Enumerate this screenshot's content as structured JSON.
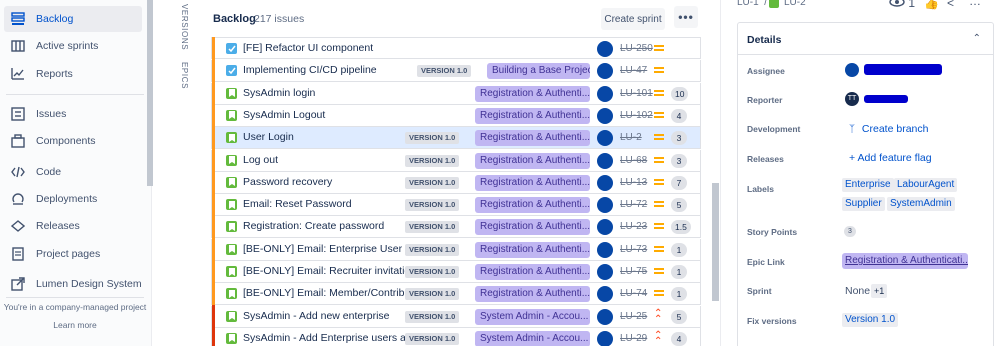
{
  "sidebar": {
    "items": [
      {
        "label": "Backlog",
        "icon": "backlog-icon",
        "active": true
      },
      {
        "label": "Active sprints",
        "icon": "board-icon"
      },
      {
        "label": "Reports",
        "icon": "reports-icon"
      },
      {
        "label": "Issues",
        "icon": "issues-icon"
      },
      {
        "label": "Components",
        "icon": "components-icon"
      },
      {
        "label": "Code",
        "icon": "code-icon"
      },
      {
        "label": "Deployments",
        "icon": "deployments-icon"
      },
      {
        "label": "Releases",
        "icon": "releases-icon"
      },
      {
        "label": "Project pages",
        "icon": "pages-icon"
      },
      {
        "label": "Lumen Design System",
        "icon": "external-link-icon"
      }
    ],
    "footer_text": "You're in a company-managed project",
    "learn_more": "Learn more"
  },
  "vertical_tabs": {
    "versions": "VERSIONS",
    "epics": "EPICS"
  },
  "backlog": {
    "title": "Backlog",
    "count": "217 issues",
    "create_sprint": "Create sprint",
    "more": "•••"
  },
  "issues": [
    {
      "summary": "[FE] Refactor UI component",
      "type": "task",
      "version": "",
      "epic": "",
      "key": "LU-250",
      "priority": "medium",
      "points": ""
    },
    {
      "summary": "Implementing CI/CD pipeline",
      "type": "task",
      "version": "VERSION 1.0",
      "epic": "Building a Base Project",
      "key": "LU-47",
      "priority": "medium",
      "points": ""
    },
    {
      "summary": "SysAdmin login",
      "type": "story",
      "version": "",
      "epic": "Registration & Authenti...",
      "key": "LU-101",
      "priority": "medium",
      "points": "10"
    },
    {
      "summary": "SysAdmin Logout",
      "type": "story",
      "version": "",
      "epic": "Registration & Authenti...",
      "key": "LU-102",
      "priority": "medium",
      "points": "4"
    },
    {
      "summary": "User Login",
      "type": "story",
      "version": "VERSION 1.0",
      "epic": "Registration & Authenti...",
      "key": "LU-2",
      "priority": "medium",
      "points": "3",
      "selected": true
    },
    {
      "summary": "Log out",
      "type": "story",
      "version": "VERSION 1.0",
      "epic": "Registration & Authenti...",
      "key": "LU-68",
      "priority": "medium",
      "points": "3"
    },
    {
      "summary": "Password recovery",
      "type": "story",
      "version": "VERSION 1.0",
      "epic": "Registration & Authenti...",
      "key": "LU-13",
      "priority": "medium",
      "points": "7"
    },
    {
      "summary": "Email: Reset Password",
      "type": "story",
      "version": "VERSION 1.0",
      "epic": "Registration & Authenti...",
      "key": "LU-72",
      "priority": "medium",
      "points": "5"
    },
    {
      "summary": "Registration: Create password",
      "type": "story",
      "version": "VERSION 1.0",
      "epic": "Registration & Authenti...",
      "key": "LU-23",
      "priority": "medium",
      "points": "1.5"
    },
    {
      "summary": "[BE-ONLY] Email: Enterprise User invitation",
      "type": "story",
      "version": "VERSION 1.0",
      "epic": "Registration & Authenti...",
      "key": "LU-73",
      "priority": "medium",
      "points": "1"
    },
    {
      "summary": "[BE-ONLY] Email: Recruiter invitation",
      "type": "story",
      "version": "VERSION 1.0",
      "epic": "Registration & Authenti...",
      "key": "LU-75",
      "priority": "medium",
      "points": "1"
    },
    {
      "summary": "[BE-ONLY] Email: Member/Contributor Invitation",
      "type": "story",
      "version": "VERSION 1.0",
      "epic": "Registration & Authenti...",
      "key": "LU-74",
      "priority": "medium",
      "points": "1"
    },
    {
      "summary": "SysAdmin - Add new enterprise",
      "type": "story",
      "version": "VERSION 1.0",
      "epic": "System Admin - Accou...",
      "key": "LU-25",
      "priority": "high",
      "points": "5",
      "barRed": true
    },
    {
      "summary": "SysAdmin - Add Enterprise users and admins",
      "type": "story",
      "version": "VERSION 1.0",
      "epic": "System Admin - Accou...",
      "key": "LU-29",
      "priority": "high",
      "points": "4",
      "barRed": true
    }
  ],
  "panel": {
    "breadcrumb_key1": "LU-1",
    "breadcrumb_sep": "/",
    "breadcrumb_key2": "LU-2",
    "watch_count": "1",
    "details_title": "Details",
    "fields": {
      "assignee_label": "Assignee",
      "reporter_label": "Reporter",
      "reporter_initials": "TT",
      "development_label": "Development",
      "create_branch": "Create branch",
      "releases_label": "Releases",
      "add_flag": "+ Add feature flag",
      "labels_label": "Labels",
      "labels": [
        "Enterprise",
        "LabourAgent",
        "Supplier",
        "SystemAdmin"
      ],
      "story_points_label": "Story Points",
      "story_points": "3",
      "epic_link_label": "Epic Link",
      "epic_link": "Registration & Authenticati...",
      "sprint_label": "Sprint",
      "sprint_value": "None",
      "sprint_extra": "+1",
      "fix_versions_label": "Fix versions",
      "fix_version": "Version 1.0"
    }
  },
  "colors": {
    "accent": "#0052cc",
    "epic_bg": "#c0b6f2",
    "story": "#63ba3c",
    "task": "#4bade8",
    "redaction": "#0000cc"
  }
}
